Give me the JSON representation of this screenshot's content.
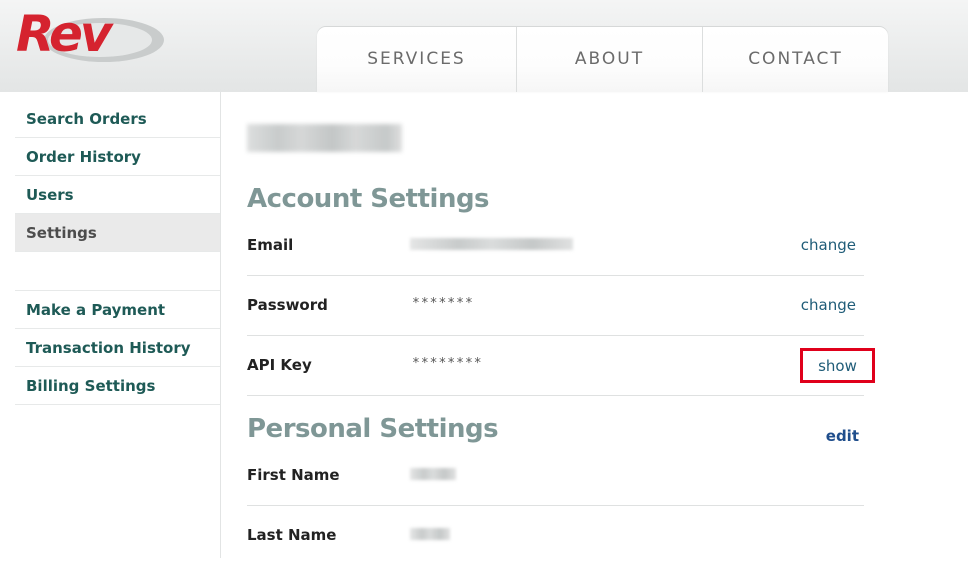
{
  "brand": {
    "logo_text": "Rev",
    "accent_color": "#d5232f",
    "text_color": "#1e5a56"
  },
  "nav": {
    "tabs": [
      "SERVICES",
      "ABOUT",
      "CONTACT"
    ]
  },
  "sidebar": {
    "group1": [
      "Search Orders",
      "Order History",
      "Users",
      "Settings"
    ],
    "group2": [
      "Make a Payment",
      "Transaction History",
      "Billing Settings"
    ],
    "active": "Settings"
  },
  "main": {
    "account_settings": {
      "title": "Account Settings",
      "rows": [
        {
          "label": "Email",
          "value": "",
          "action": "change"
        },
        {
          "label": "Password",
          "value": "*******",
          "action": "change"
        },
        {
          "label": "API Key",
          "value": "********",
          "action": "show"
        }
      ]
    },
    "personal_settings": {
      "title": "Personal Settings",
      "edit_label": "edit",
      "rows": [
        {
          "label": "First Name",
          "value": ""
        },
        {
          "label": "Last Name",
          "value": ""
        }
      ]
    }
  }
}
